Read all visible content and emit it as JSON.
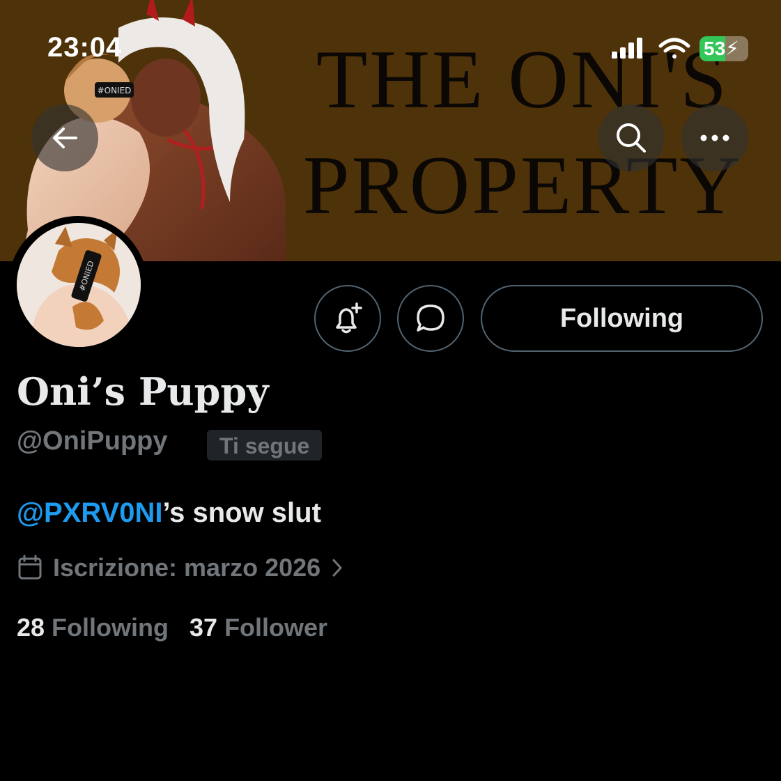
{
  "status_bar": {
    "time": "23:04",
    "battery_percent": "53",
    "battery_level": 0.53,
    "icons": [
      "cellular-signal-icon",
      "wifi-icon",
      "battery-charging-icon"
    ]
  },
  "banner": {
    "title_line1": "THE ONI'S",
    "title_line2": "PROPERTY",
    "art_badge": "#ONIED",
    "background_color": "#4e3209"
  },
  "header_actions": {
    "icons": [
      "back-arrow-icon",
      "search-icon",
      "more-icon"
    ]
  },
  "avatar": {
    "badge_text": "#ONIED"
  },
  "profile_actions": {
    "following_label": "Following",
    "icons": [
      "notification-bell-plus-icon",
      "message-bubble-icon"
    ]
  },
  "profile": {
    "display_name": "Oni’s Puppy",
    "handle": "@OniPuppy",
    "follows_you": "Ti segue",
    "bio_mention": "@PXRV0NI",
    "bio_rest": "’s snow slut",
    "join_date": "Iscrizione: marzo 2026"
  },
  "stats": {
    "following_count": "28",
    "following_label": "Following",
    "followers_count": "37",
    "followers_label": "Follower"
  },
  "colors": {
    "background": "#000000",
    "primary_text": "#e7e9ea",
    "secondary_text": "#71767b",
    "link": "#1d9bf0",
    "border": "#536471",
    "battery_green": "#33c759"
  }
}
